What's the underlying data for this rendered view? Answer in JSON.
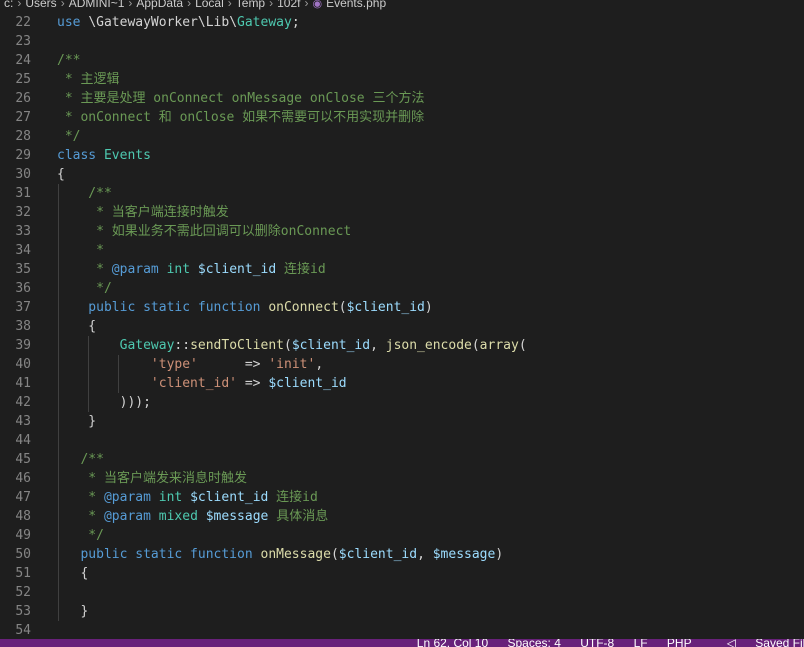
{
  "breadcrumb": {
    "segments": [
      "c:",
      "Users",
      "ADMINI~1",
      "AppData",
      "Local",
      "Temp",
      "102f"
    ],
    "file": "Events.php"
  },
  "editor": {
    "lines": [
      {
        "n": "22",
        "indent": 0,
        "tokens": [
          [
            "k",
            "use "
          ],
          [
            "p",
            "\\GatewayWorker\\Lib\\"
          ],
          [
            "cls",
            "Gateway"
          ],
          [
            "p",
            ";"
          ]
        ]
      },
      {
        "n": "23",
        "indent": 0,
        "tokens": []
      },
      {
        "n": "24",
        "indent": 0,
        "tokens": [
          [
            "c",
            "/**"
          ]
        ]
      },
      {
        "n": "25",
        "indent": 0,
        "tokens": [
          [
            "c",
            " * 主逻辑"
          ]
        ]
      },
      {
        "n": "26",
        "indent": 0,
        "tokens": [
          [
            "c",
            " * 主要是处理 onConnect onMessage onClose 三个方法"
          ]
        ]
      },
      {
        "n": "27",
        "indent": 0,
        "tokens": [
          [
            "c",
            " * onConnect 和 onClose 如果不需要可以不用实现并删除"
          ]
        ]
      },
      {
        "n": "28",
        "indent": 0,
        "tokens": [
          [
            "c",
            " */"
          ]
        ]
      },
      {
        "n": "29",
        "indent": 0,
        "tokens": [
          [
            "k",
            "class "
          ],
          [
            "cls",
            "Events"
          ]
        ]
      },
      {
        "n": "30",
        "indent": 0,
        "tokens": [
          [
            "p",
            "{"
          ]
        ]
      },
      {
        "n": "31",
        "indent": 1,
        "tokens": [
          [
            "c",
            "    /**"
          ]
        ]
      },
      {
        "n": "32",
        "indent": 1,
        "tokens": [
          [
            "c",
            "     * 当客户端连接时触发"
          ]
        ]
      },
      {
        "n": "33",
        "indent": 1,
        "tokens": [
          [
            "c",
            "     * 如果业务不需此回调可以删除onConnect"
          ]
        ]
      },
      {
        "n": "34",
        "indent": 1,
        "tokens": [
          [
            "c",
            "     *"
          ]
        ]
      },
      {
        "n": "35",
        "indent": 1,
        "tokens": [
          [
            "c",
            "     * "
          ],
          [
            "k",
            "@param "
          ],
          [
            "cls",
            "int "
          ],
          [
            "v",
            "$client_id "
          ],
          [
            "c",
            "连接id"
          ]
        ]
      },
      {
        "n": "36",
        "indent": 1,
        "tokens": [
          [
            "c",
            "     */"
          ]
        ]
      },
      {
        "n": "37",
        "indent": 1,
        "tokens": [
          [
            "k",
            "    public static function "
          ],
          [
            "fn",
            "onConnect"
          ],
          [
            "p",
            "("
          ],
          [
            "v",
            "$client_id"
          ],
          [
            "p",
            ")"
          ]
        ]
      },
      {
        "n": "38",
        "indent": 1,
        "tokens": [
          [
            "p",
            "    {"
          ]
        ]
      },
      {
        "n": "39",
        "indent": 2,
        "tokens": [
          [
            "cls",
            "        Gateway"
          ],
          [
            "p",
            "::"
          ],
          [
            "fn",
            "sendToClient"
          ],
          [
            "p",
            "("
          ],
          [
            "v",
            "$client_id"
          ],
          [
            "p",
            ", "
          ],
          [
            "fn",
            "json_encode"
          ],
          [
            "p",
            "("
          ],
          [
            "fn",
            "array"
          ],
          [
            "p",
            "("
          ]
        ]
      },
      {
        "n": "40",
        "indent": 3,
        "tokens": [
          [
            "s",
            "            'type'"
          ],
          [
            "p",
            "      => "
          ],
          [
            "s",
            "'init'"
          ],
          [
            "p",
            ","
          ]
        ]
      },
      {
        "n": "41",
        "indent": 3,
        "tokens": [
          [
            "s",
            "            'client_id'"
          ],
          [
            "p",
            " => "
          ],
          [
            "v",
            "$client_id"
          ]
        ]
      },
      {
        "n": "42",
        "indent": 2,
        "tokens": [
          [
            "p",
            "        )));"
          ]
        ]
      },
      {
        "n": "43",
        "indent": 1,
        "tokens": [
          [
            "p",
            "    }"
          ]
        ]
      },
      {
        "n": "44",
        "indent": 1,
        "tokens": []
      },
      {
        "n": "45",
        "indent": 1,
        "tokens": [
          [
            "c",
            "   /**"
          ]
        ]
      },
      {
        "n": "46",
        "indent": 1,
        "tokens": [
          [
            "c",
            "    * 当客户端发来消息时触发"
          ]
        ]
      },
      {
        "n": "47",
        "indent": 1,
        "tokens": [
          [
            "c",
            "    * "
          ],
          [
            "k",
            "@param "
          ],
          [
            "cls",
            "int "
          ],
          [
            "v",
            "$client_id "
          ],
          [
            "c",
            "连接id"
          ]
        ]
      },
      {
        "n": "48",
        "indent": 1,
        "tokens": [
          [
            "c",
            "    * "
          ],
          [
            "k",
            "@param "
          ],
          [
            "cls",
            "mixed "
          ],
          [
            "v",
            "$message "
          ],
          [
            "c",
            "具体消息"
          ]
        ]
      },
      {
        "n": "49",
        "indent": 1,
        "tokens": [
          [
            "c",
            "    */"
          ]
        ]
      },
      {
        "n": "50",
        "indent": 1,
        "tokens": [
          [
            "k",
            "   public static function "
          ],
          [
            "fn",
            "onMessage"
          ],
          [
            "p",
            "("
          ],
          [
            "v",
            "$client_id"
          ],
          [
            "p",
            ", "
          ],
          [
            "v",
            "$message"
          ],
          [
            "p",
            ")"
          ]
        ]
      },
      {
        "n": "51",
        "indent": 1,
        "tokens": [
          [
            "p",
            "   {"
          ]
        ]
      },
      {
        "n": "52",
        "indent": 1,
        "tokens": []
      },
      {
        "n": "53",
        "indent": 1,
        "tokens": [
          [
            "p",
            "   }"
          ]
        ]
      },
      {
        "n": "54",
        "indent": 0,
        "tokens": []
      }
    ]
  },
  "statusbar": {
    "position": "Ln 62, Col 10",
    "spaces": "Spaces: 4",
    "encoding": "UTF-8",
    "eol": "LF",
    "language": "PHP",
    "saved": "Saved File"
  }
}
